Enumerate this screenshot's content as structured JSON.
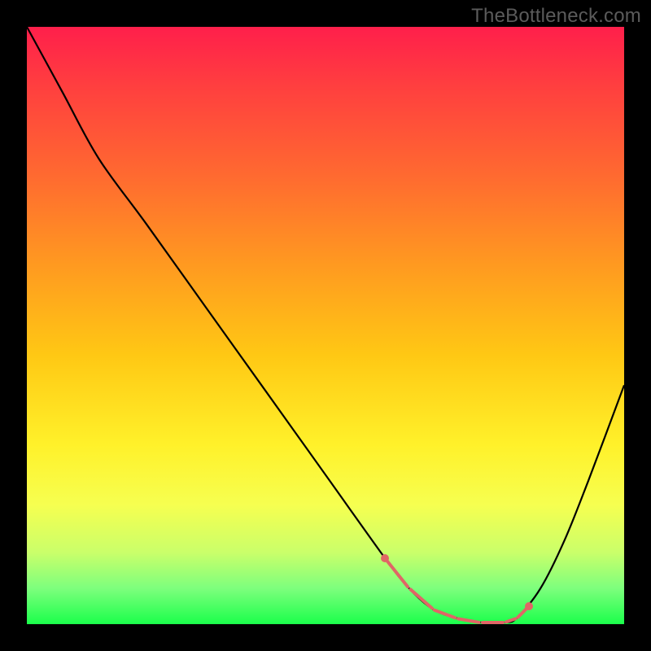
{
  "watermark": "TheBottleneck.com",
  "chart_data": {
    "type": "line",
    "title": "",
    "xlabel": "",
    "ylabel": "",
    "xlim": [
      0,
      100
    ],
    "ylim": [
      0,
      100
    ],
    "series": [
      {
        "name": "curve",
        "x": [
          0,
          6,
          12,
          20,
          30,
          40,
          50,
          60,
          64,
          68,
          72,
          76,
          80,
          82,
          86,
          90,
          94,
          100
        ],
        "values": [
          100,
          89,
          78,
          67,
          53,
          39,
          25,
          11,
          6,
          2.5,
          1,
          0.3,
          0.3,
          1,
          6,
          14,
          24,
          40
        ]
      }
    ],
    "highlight": {
      "name": "bottleneck-band",
      "color": "#e06666",
      "points_x": [
        60,
        64,
        68,
        72,
        76,
        80,
        82,
        84
      ],
      "points_y": [
        11,
        6,
        2.5,
        1,
        0.3,
        0.3,
        1,
        3
      ]
    }
  },
  "colors": {
    "frame": "#000000",
    "gradient_top": "#ff1f4b",
    "gradient_bottom": "#1bff4b",
    "curve": "#000000",
    "highlight": "#e06666",
    "watermark": "#5b5b5b"
  }
}
